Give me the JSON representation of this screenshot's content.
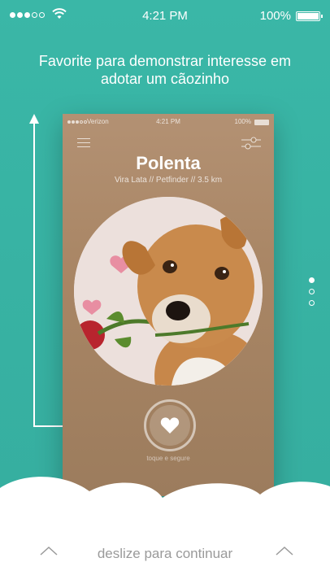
{
  "status_bar": {
    "signal_dots_filled": 3,
    "signal_dots_empty": 2,
    "wifi_icon": "wifi-icon",
    "time": "4:21 PM",
    "battery": "100%"
  },
  "onboarding": {
    "headline": "Favorite para demonstrar interesse em adotar um cãozinho",
    "page_indicator": {
      "count": 3,
      "active_index": 0
    }
  },
  "phone_preview": {
    "status": {
      "carrier": "Verizon",
      "time": "4:21 PM",
      "battery": "100%"
    },
    "menu_icon": "hamburger-menu-icon",
    "filter_icon": "sliders-filter-icon",
    "pet_name": "Polenta",
    "pet_meta": "Vira Lata // Petfinder // 3.5 km",
    "photo_alt": "dog-with-rose-photo",
    "favorite_icon": "heart-icon",
    "hold_label": "toque e segure"
  },
  "footer": {
    "swipe_text": "deslize para continuar",
    "left_icon": "chevron-up-icon",
    "right_icon": "chevron-up-icon"
  },
  "colors": {
    "teal_background": "#3ab7a7",
    "card_brown": "#a98665",
    "cloud_white": "#ffffff",
    "footer_text": "#9a9a9a"
  }
}
